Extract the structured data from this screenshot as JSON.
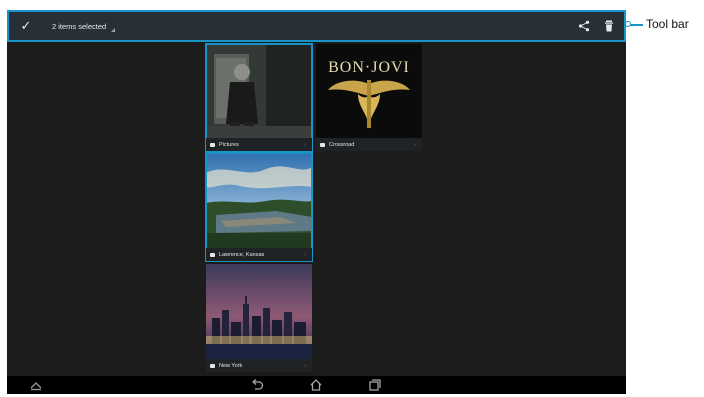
{
  "toolbar": {
    "selection_text": "2 items selected",
    "check_icon": "check-icon",
    "share_icon": "share-icon",
    "delete_icon": "trash-icon",
    "accent_color": "#1a93c6"
  },
  "albums": [
    {
      "label": "Pictures",
      "selected": true
    },
    {
      "label": "Crossroad",
      "selected": false,
      "artwork_text": "BON·JOVI"
    },
    {
      "label": "Lawrence, Kansas",
      "selected": true
    },
    {
      "label": "New York",
      "selected": false
    }
  ],
  "navbar": {
    "icons": [
      "menu-up-icon",
      "back-icon",
      "home-icon",
      "recents-icon"
    ]
  },
  "callout": {
    "label": "Tool bar"
  }
}
